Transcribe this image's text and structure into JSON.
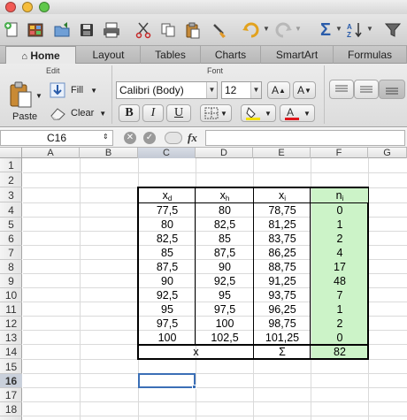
{
  "toolbar": {
    "icons": [
      "new-workbook-icon",
      "templates-icon",
      "open-icon",
      "save-icon",
      "print-icon",
      "cut-icon",
      "copy-icon",
      "paste-icon",
      "format-painter-icon",
      "undo-icon",
      "redo-icon",
      "autosum-icon",
      "sort-icon",
      "filter-icon"
    ]
  },
  "ribbon": {
    "tabs": [
      "Home",
      "Layout",
      "Tables",
      "Charts",
      "SmartArt",
      "Formulas"
    ],
    "active_tab": "Home",
    "groups": {
      "edit": "Edit",
      "font": "Font"
    },
    "paste_label": "Paste",
    "fill_label": "Fill",
    "clear_label": "Clear",
    "font_name": "Calibri (Body)",
    "font_size": "12",
    "font_grow_label": "A",
    "font_shrink_label": "A",
    "bold_label": "B",
    "italic_label": "I",
    "underline_label": "U"
  },
  "formula_bar": {
    "name_box": "C16",
    "fx_label": "fx",
    "formula": ""
  },
  "sheet": {
    "columns": [
      "A",
      "B",
      "C",
      "D",
      "E",
      "F",
      "G"
    ],
    "rows": [
      "1",
      "2",
      "3",
      "4",
      "5",
      "6",
      "7",
      "8",
      "9",
      "10",
      "11",
      "12",
      "13",
      "14",
      "15",
      "16",
      "17",
      "18"
    ],
    "selected_cell": "C16",
    "table": {
      "headers": {
        "xd": "x",
        "xd_sub": "d",
        "xh": "x",
        "xh_sub": "h",
        "xi": "x",
        "xi_sub": "i",
        "ni": "n",
        "ni_sub": "i"
      },
      "rows": [
        [
          "77,5",
          "80",
          "78,75",
          "0"
        ],
        [
          "80",
          "82,5",
          "81,25",
          "1"
        ],
        [
          "82,5",
          "85",
          "83,75",
          "2"
        ],
        [
          "85",
          "87,5",
          "86,25",
          "4"
        ],
        [
          "87,5",
          "90",
          "88,75",
          "17"
        ],
        [
          "90",
          "92,5",
          "91,25",
          "48"
        ],
        [
          "92,5",
          "95",
          "93,75",
          "7"
        ],
        [
          "95",
          "97,5",
          "96,25",
          "1"
        ],
        [
          "97,5",
          "100",
          "98,75",
          "2"
        ],
        [
          "100",
          "102,5",
          "101,25",
          "0"
        ]
      ],
      "footer": {
        "label": "x",
        "sigma": "Σ",
        "total": "82"
      }
    }
  },
  "colors": {
    "green_fill": "#ccf3c8",
    "selection": "#3b6fb6",
    "font_highlight": "#f4e100",
    "font_color": "#e0161b"
  }
}
